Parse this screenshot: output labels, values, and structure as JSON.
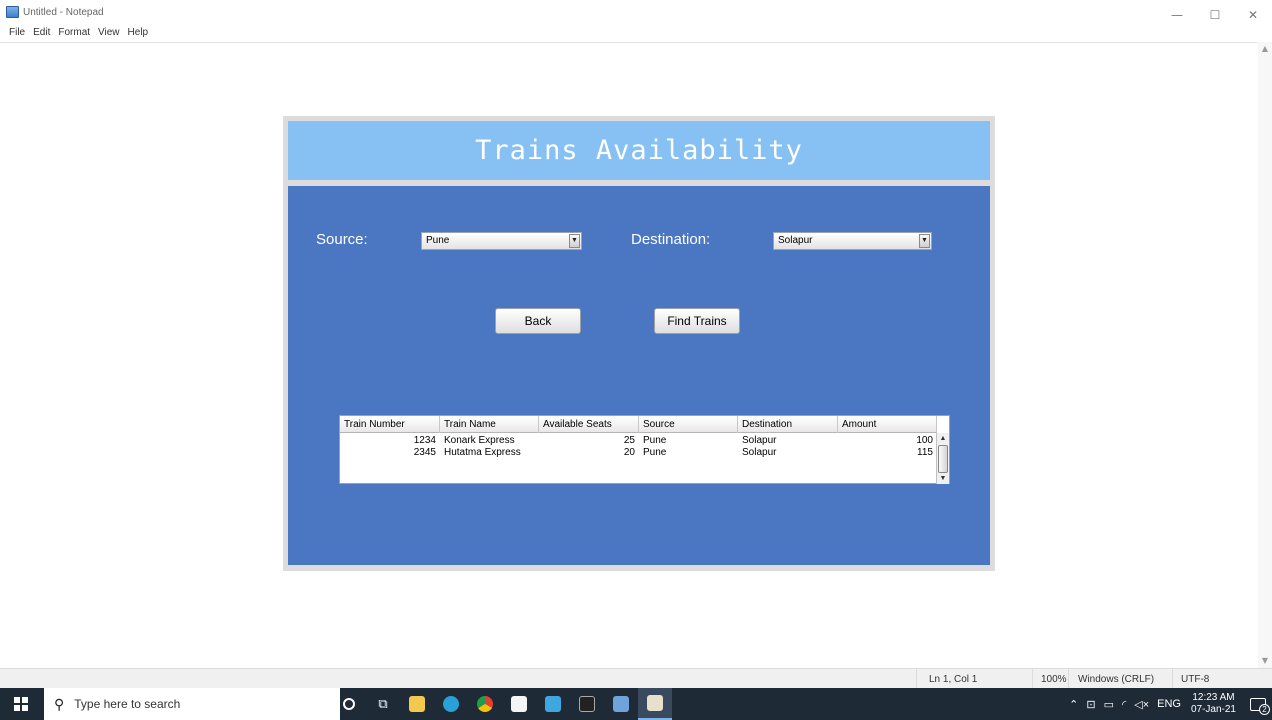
{
  "notepad": {
    "title": "Untitled - Notepad",
    "menu": [
      "File",
      "Edit",
      "Format",
      "View",
      "Help"
    ],
    "window_controls": {
      "minimize": "—",
      "maximize": "☐",
      "close": "✕"
    },
    "status": {
      "position": "Ln 1, Col 1",
      "zoom": "100%",
      "line_ending": "Windows (CRLF)",
      "encoding": "UTF-8"
    }
  },
  "app": {
    "title": "Trains Availability",
    "source_label": "Source:",
    "source_value": "Pune",
    "destination_label": "Destination:",
    "destination_value": "Solapur",
    "back_label": "Back",
    "find_label": "Find Trains",
    "table": {
      "columns": [
        "Train Number",
        "Train Name",
        "Available Seats",
        "Source",
        "Destination",
        "Amount"
      ],
      "rows": [
        [
          "1234",
          "Konark Express",
          "25",
          "Pune",
          "Solapur",
          "100"
        ],
        [
          "2345",
          "Hutatma Express",
          "20",
          "Pune",
          "Solapur",
          "115"
        ]
      ]
    }
  },
  "taskbar": {
    "search_placeholder": "Type here to search",
    "apps": [
      "cortana-icon",
      "task-view-icon",
      "file-explorer-icon",
      "edge-icon",
      "chrome-icon",
      "store-icon",
      "app-icon",
      "terminal-icon",
      "notepad-icon",
      "java-icon"
    ],
    "tray": {
      "language": "ENG",
      "time": "12:23 AM",
      "date": "07-Jan-21",
      "notifications": "2"
    }
  },
  "colors": {
    "header_bg": "#87c1f3",
    "body_bg": "#4a76c2",
    "frame": "#dcdcdc",
    "taskbar": "#1f2a37"
  }
}
